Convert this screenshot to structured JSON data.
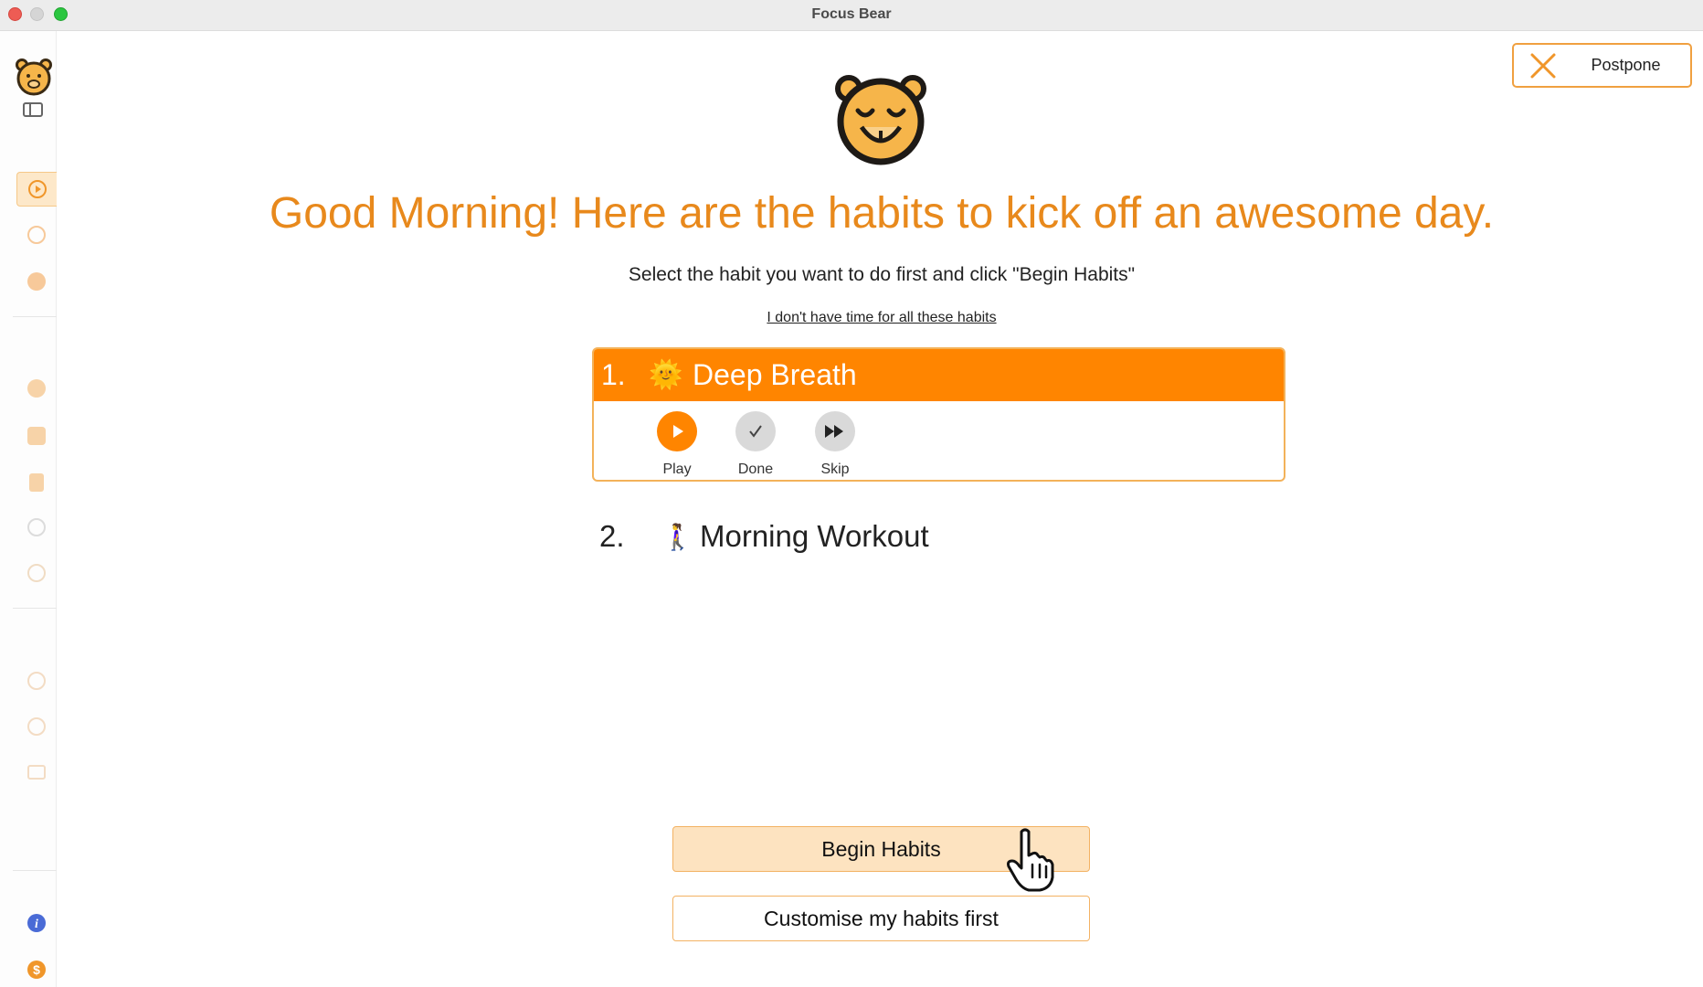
{
  "window": {
    "title": "Focus Bear"
  },
  "header": {
    "postpone_label": "Postpone"
  },
  "main": {
    "headline": "Good Morning! Here are the habits to kick off an awesome day.",
    "subtitle": "Select the habit you want to do first and click \"Begin Habits\"",
    "no_time_link": "I don't have time for all these habits"
  },
  "habits": [
    {
      "number": "1.",
      "emoji": "🌞",
      "name": "Deep Breath",
      "actions": [
        {
          "label": "Play",
          "icon": "play-icon",
          "color": "#ff8500"
        },
        {
          "label": "Done",
          "icon": "check-icon",
          "color": "#d9d9d9"
        },
        {
          "label": "Skip",
          "icon": "fast-forward-icon",
          "color": "#d9d9d9"
        }
      ]
    },
    {
      "number": "2.",
      "emoji": "🚶‍♀️",
      "name": "Morning Workout"
    }
  ],
  "buttons": {
    "begin": "Begin Habits",
    "customise": "Customise my habits first"
  },
  "colors": {
    "accent": "#ff8500",
    "headline": "#e8891c",
    "button_fill": "#fde3c0",
    "border": "#f3b263"
  },
  "sidebar_icons": [
    "routine-play-icon",
    "timer-icon",
    "info-icon",
    "habits-icon",
    "box-icon",
    "notes-icon",
    "profile-icon",
    "compass-icon",
    "add-icon",
    "settings-icon",
    "mail-icon",
    "about-icon",
    "billing-icon"
  ]
}
